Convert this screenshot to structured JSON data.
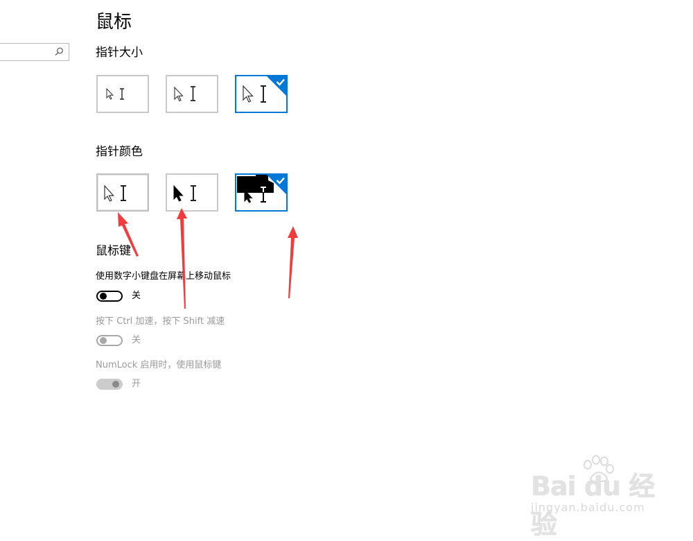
{
  "page": {
    "title": "鼠标"
  },
  "search": {
    "icon": "search-icon",
    "value": ""
  },
  "pointer_size": {
    "heading": "指针大小",
    "options": [
      {
        "size": "small",
        "selected": false
      },
      {
        "size": "medium",
        "selected": false
      },
      {
        "size": "large",
        "selected": true
      }
    ]
  },
  "pointer_color": {
    "heading": "指针颜色",
    "options": [
      {
        "scheme": "white",
        "selected": false
      },
      {
        "scheme": "black",
        "selected": false
      },
      {
        "scheme": "inverted",
        "selected": true
      }
    ]
  },
  "mouse_keys": {
    "heading": "鼠标键",
    "settings": [
      {
        "label": "使用数字小键盘在屏幕上移动鼠标",
        "state": "关",
        "on": false,
        "enabled": true
      },
      {
        "label": "按下 Ctrl 加速，按下 Shift 减速",
        "state": "关",
        "on": false,
        "enabled": false
      },
      {
        "label": "NumLock 启用时，使用鼠标键",
        "state": "开",
        "on": true,
        "enabled": false
      }
    ]
  },
  "annotations": {
    "arrow_color": "#f03c3c",
    "arrow_count": 3
  },
  "colors": {
    "accent": "#0078d7",
    "card_border": "#c8c8c8",
    "disabled_text": "#9a9a9a"
  },
  "watermark": {
    "brand": "Bai du 经验",
    "url": "jingyan.baidu.com"
  }
}
